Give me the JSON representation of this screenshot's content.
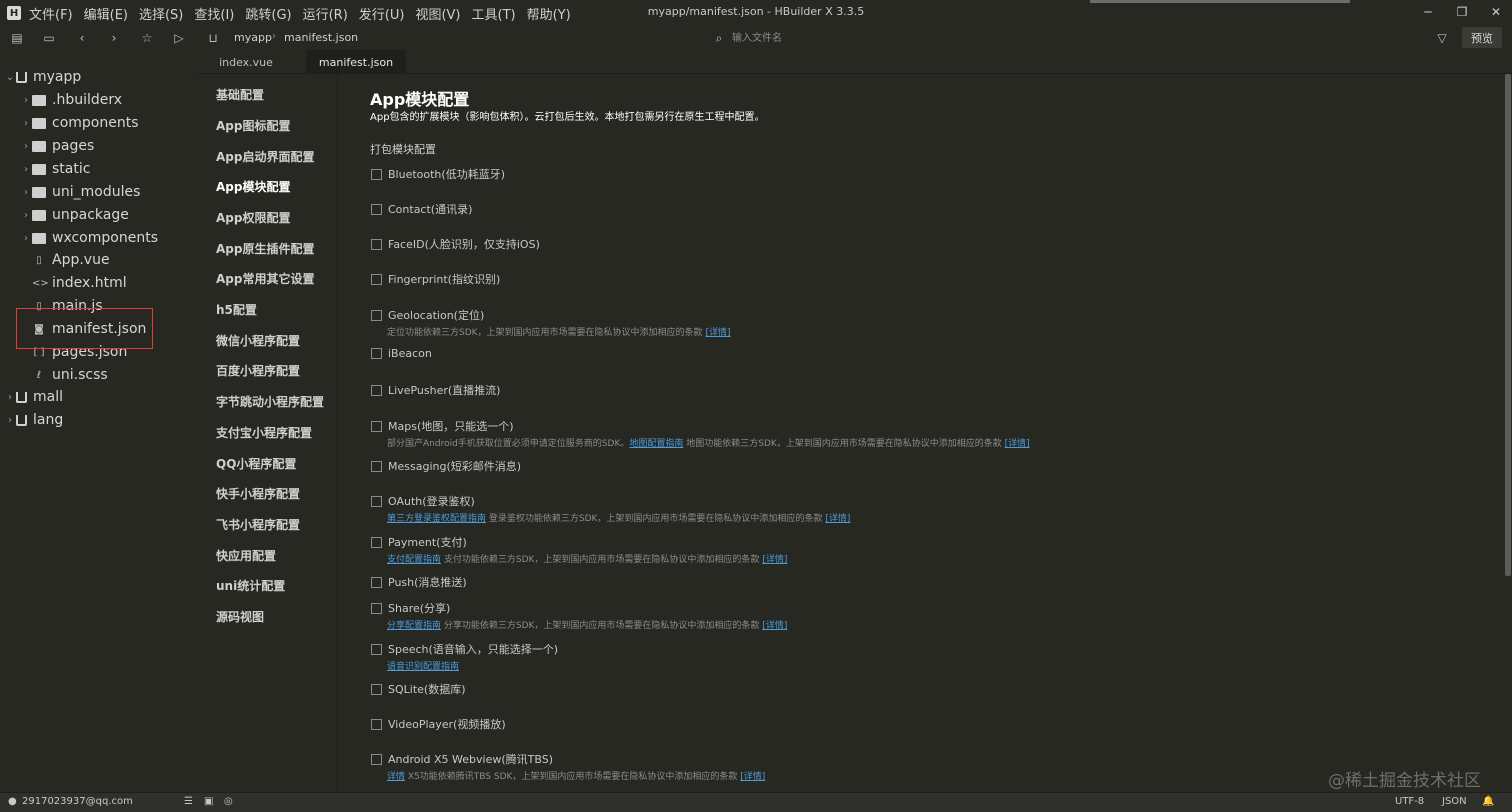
{
  "window": {
    "title": "myapp/manifest.json - HBuilder X 3.3.5",
    "logo_icon": "hbuilder-logo-icon"
  },
  "menu": [
    {
      "label": "文件(F)"
    },
    {
      "label": "编辑(E)"
    },
    {
      "label": "选择(S)"
    },
    {
      "label": "查找(I)"
    },
    {
      "label": "跳转(G)"
    },
    {
      "label": "运行(R)"
    },
    {
      "label": "发行(U)"
    },
    {
      "label": "视图(V)"
    },
    {
      "label": "工具(T)"
    },
    {
      "label": "帮助(Y)"
    }
  ],
  "toolbar": {
    "breadcrumb_project": "myapp",
    "breadcrumb_file": "manifest.json",
    "search_placeholder": "输入文件名",
    "preview_label": "预览"
  },
  "file_tree": {
    "root": "myapp",
    "items": [
      {
        "label": ".hbuilderx",
        "type": "folder"
      },
      {
        "label": "components",
        "type": "folder"
      },
      {
        "label": "pages",
        "type": "folder"
      },
      {
        "label": "static",
        "type": "folder"
      },
      {
        "label": "uni_modules",
        "type": "folder"
      },
      {
        "label": "unpackage",
        "type": "folder"
      },
      {
        "label": "wxcomponents",
        "type": "folder"
      },
      {
        "label": "App.vue",
        "type": "file"
      },
      {
        "label": "index.html",
        "type": "file"
      },
      {
        "label": "main.js",
        "type": "file"
      },
      {
        "label": "manifest.json",
        "type": "file"
      },
      {
        "label": "pages.json",
        "type": "file"
      },
      {
        "label": "uni.scss",
        "type": "file"
      }
    ],
    "other_projects": [
      "mall",
      "lang"
    ]
  },
  "tabs": [
    {
      "label": "index.vue"
    },
    {
      "label": "manifest.json"
    }
  ],
  "settings_nav": [
    "基础配置",
    "App图标配置",
    "App启动界面配置",
    "App模块配置",
    "App权限配置",
    "App原生插件配置",
    "App常用其它设置",
    "h5配置",
    "微信小程序配置",
    "百度小程序配置",
    "字节跳动小程序配置",
    "支付宝小程序配置",
    "QQ小程序配置",
    "快手小程序配置",
    "飞书小程序配置",
    "快应用配置",
    "uni统计配置",
    "源码视图"
  ],
  "content": {
    "title": "App模块配置",
    "description": "App包含的扩展模块（影响包体积）。云打包后生效。本地打包需另行在原生工程中配置。",
    "section_title": "打包模块配置",
    "modules": [
      {
        "label": "Bluetooth(低功耗蓝牙)"
      },
      {
        "label": "Contact(通讯录)"
      },
      {
        "label": "FaceID(人脸识别，仅支持iOS)"
      },
      {
        "label": "Fingerprint(指纹识别)"
      },
      {
        "label": "Geolocation(定位)",
        "note": "定位功能依赖三方SDK，上架到国内应用市场需要在隐私协议中添加相应的条款",
        "note_link": "[详情]"
      },
      {
        "label": "iBeacon"
      },
      {
        "label": "LivePusher(直播推流)"
      },
      {
        "label": "Maps(地图，只能选一个)",
        "note": "部分国产Android手机获取位置必须申请定位服务商的SDK。",
        "note_link": "地图配置指南",
        "note2": "地图功能依赖三方SDK，上架到国内应用市场需要在隐私协议中添加相应的条款",
        "note2_link": "[详情]"
      },
      {
        "label": "Messaging(短彩邮件消息)"
      },
      {
        "label": "OAuth(登录鉴权)",
        "note_link_first": "第三方登录鉴权配置指南",
        "note": "登录鉴权功能依赖三方SDK，上架到国内应用市场需要在隐私协议中添加相应的条款",
        "note_link": "[详情]"
      },
      {
        "label": "Payment(支付)",
        "note_link_first": "支付配置指南",
        "note": "支付功能依赖三方SDK，上架到国内应用市场需要在隐私协议中添加相应的条款",
        "note_link": "[详情]"
      },
      {
        "label": "Push(消息推送)"
      },
      {
        "label": "Share(分享)",
        "note_link_first": "分享配置指南",
        "note": "分享功能依赖三方SDK，上架到国内应用市场需要在隐私协议中添加相应的条款",
        "note_link": "[详情]"
      },
      {
        "label": "Speech(语音输入，只能选择一个)",
        "note_link_first": "语音识别配置指南"
      },
      {
        "label": "SQLite(数据库)"
      },
      {
        "label": "VideoPlayer(视频播放)"
      },
      {
        "label": "Android X5 Webview(腾讯TBS)",
        "note_link_first": "详情",
        "note": "X5功能依赖腾讯TBS SDK，上架到国内应用市场需要在隐私协议中添加相应的条款",
        "note_link": "[详情]"
      }
    ]
  },
  "statusbar": {
    "account": "2917023937@qq.com",
    "encoding": "UTF-8",
    "language": "JSON"
  },
  "watermark": "@稀土掘金技术社区"
}
